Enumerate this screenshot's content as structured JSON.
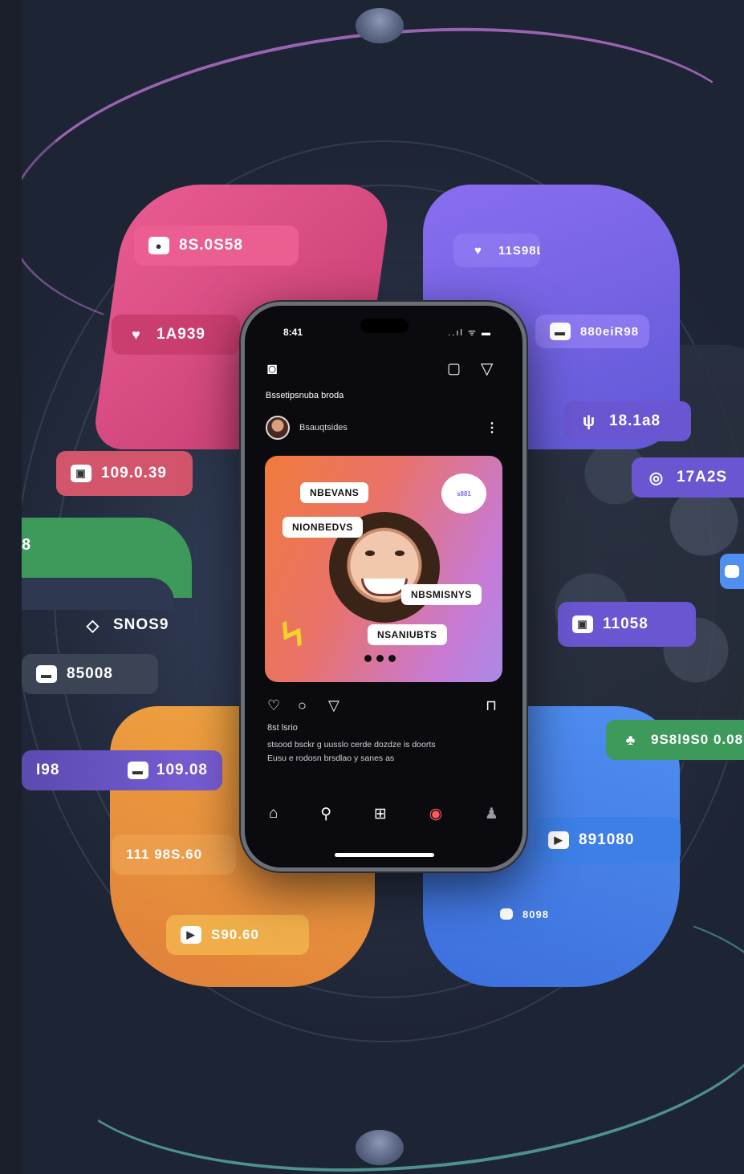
{
  "status": {
    "time": "8:41",
    "signal": "..ıl ᯤ ▬"
  },
  "app": {
    "handle": "Bssetipsnuba broda",
    "username": "Bsauqtsides"
  },
  "post": {
    "tags": [
      "NBEVANS",
      "NIONBEDVS",
      "NBSMISNYS",
      "NSANIUBTS"
    ],
    "bubble": "s881",
    "likes": "8st  lsrio",
    "caption_line1": "stsood  bsckr g uusslo cerde dozdze is doorts",
    "caption_line2": "Eusu e rodosn  brsdlao y sanes as"
  },
  "stats": {
    "pink_top": "8S.0S58",
    "pink_mid": "1A939",
    "red_left": "109.0.39",
    "green_left": "8",
    "white_left": "SNOS9",
    "dark_left": "85008",
    "purple_left_a": "I98",
    "purple_left_b": "109.08",
    "orange_a": "111  98S.60",
    "orange_b": "S90.60",
    "purple_top": "11S98L",
    "purple_mid": "880eiR98",
    "purple_right_a": "18.1a8",
    "purple_right_b": "17A2S",
    "purple_right_c": "11058",
    "green_right": "9S8l9S0 0.08",
    "blue_a": "891080",
    "blue_b": "8098"
  },
  "colors": {
    "pink": "#e85c92",
    "purple": "#6f62e6",
    "orange": "#f0a640",
    "blue": "#4f8ff0",
    "green": "#3e9a5b"
  }
}
